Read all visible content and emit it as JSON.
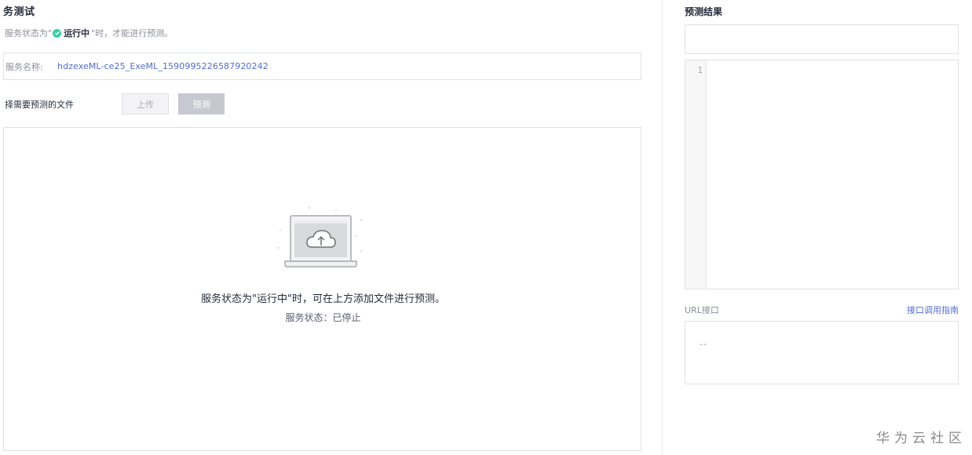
{
  "left": {
    "title": "务测试",
    "hint": {
      "prefix": "服务状态为\"",
      "status": "运行中",
      "suffix": "\"时，才能进行预测。"
    },
    "service": {
      "label": "服务名称:",
      "name": "hdzexeML-ce25_ExeML_1590995226587920242"
    },
    "choose_label": "择需要预测的文件",
    "upload_label": "上传",
    "predict_label": "预测",
    "dropzone": {
      "message": "服务状态为\"运行中\"时，可在上方添加文件进行预测。",
      "status": "服务状态：已停止"
    }
  },
  "right": {
    "title": "预测结果",
    "editor_line": "1",
    "url_label": "URL接口",
    "guide_link": "接口调用指南",
    "url_value": "--"
  },
  "watermark": "华为云社区",
  "colors": {
    "accent": "#526ecc",
    "success": "#3dcca6",
    "border": "#dfe1e6",
    "disabled_button": "#c6c9cf"
  }
}
